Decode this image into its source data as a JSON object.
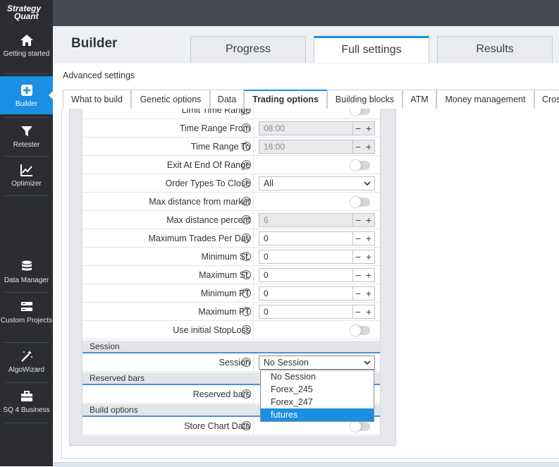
{
  "app": {
    "logo_line1": "Strategy",
    "logo_line2": "Quant"
  },
  "sidebar": {
    "items": [
      {
        "label": "Getting started",
        "icon": "home-icon"
      },
      {
        "label": "Builder",
        "icon": "plus-square-icon",
        "active": true
      },
      {
        "label": "Retester",
        "icon": "filter-icon"
      },
      {
        "label": "Optimizer",
        "icon": "chart-line-icon"
      },
      {
        "label": "Data Manager",
        "icon": "database-icon"
      },
      {
        "label": "Custom Projects",
        "icon": "server-icon"
      },
      {
        "label": "AlgoWizard",
        "icon": "magic-wand-icon"
      },
      {
        "label": "SQ 4 Business",
        "icon": "briefcase-icon"
      }
    ]
  },
  "header": {
    "title": "Builder",
    "tabs": [
      {
        "label": "Progress"
      },
      {
        "label": "Full settings",
        "active": true
      },
      {
        "label": "Results"
      }
    ]
  },
  "advanced_settings_label": "Advanced settings",
  "subtabs": [
    {
      "label": "What to build"
    },
    {
      "label": "Genetic options"
    },
    {
      "label": "Data"
    },
    {
      "label": "Trading options",
      "active": true
    },
    {
      "label": "Building blocks"
    },
    {
      "label": "ATM"
    },
    {
      "label": "Money management"
    },
    {
      "label": "Cros"
    }
  ],
  "settings": {
    "limit_time_range": {
      "label": "Limit Time Range",
      "enabled": false
    },
    "time_range_from": {
      "label": "Time Range From",
      "value": "08:00",
      "disabled": true
    },
    "time_range_to": {
      "label": "Time Range To",
      "value": "16:00",
      "disabled": true
    },
    "exit_at_end": {
      "label": "Exit At End Of Range",
      "enabled": false
    },
    "order_types": {
      "label": "Order Types To Close",
      "value": "All"
    },
    "max_distance_market": {
      "label": "Max distance from market",
      "enabled": false
    },
    "max_distance_percent": {
      "label": "Max distance percent",
      "value": "6",
      "disabled": true
    },
    "max_trades": {
      "label": "Maximum Trades Per Day",
      "value": "0"
    },
    "min_sl": {
      "label": "Minimum SL",
      "value": "0"
    },
    "max_sl": {
      "label": "Maximum SL",
      "value": "0"
    },
    "min_pt": {
      "label": "Minimum PT",
      "value": "0"
    },
    "max_pt": {
      "label": "Maximum PT",
      "value": "0"
    },
    "use_initial_sl": {
      "label": "Use initial StopLoss",
      "enabled": false
    },
    "session_section": "Session",
    "session": {
      "label": "Session",
      "value": "No Session"
    },
    "reserved_section": "Reserved bars",
    "reserved_bars": {
      "label": "Reserved bars"
    },
    "build_section": "Build options",
    "store_chart": {
      "label": "Store Chart Data",
      "enabled": false
    }
  },
  "session_dropdown": {
    "options": [
      "No Session",
      "Forex_245",
      "Forex_247",
      "futures"
    ],
    "highlighted": "futures"
  },
  "spin_symbols": {
    "minus": "−",
    "plus": "+"
  },
  "help_glyph": "?",
  "colors": {
    "accent": "#1a8fe3",
    "sidebar": "#2b2d33",
    "topbar": "#474a52"
  }
}
